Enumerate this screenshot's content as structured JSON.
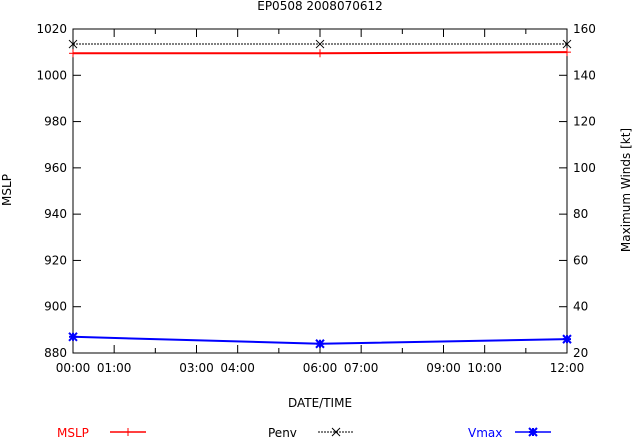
{
  "chart_data": {
    "type": "line",
    "title": "EP0508 2008070612",
    "xlabel": "DATE/TIME",
    "ylabel": "MSLP",
    "y2label": "Maximum Winds [kt]",
    "x": [
      0,
      6,
      12
    ],
    "x_tick_values": [
      0,
      1,
      3,
      4,
      6,
      7,
      9,
      10,
      12
    ],
    "x_tick_labels": [
      "00:00",
      "01:00",
      "03:00",
      "04:00",
      "06:00",
      "07:00",
      "09:00",
      "10:00",
      "12:00"
    ],
    "xlim": [
      0,
      12
    ],
    "ylim": [
      880,
      1020
    ],
    "y_ticks": [
      880,
      900,
      920,
      940,
      960,
      980,
      1000,
      1020
    ],
    "y2lim": [
      20,
      160
    ],
    "y2_ticks": [
      20,
      40,
      60,
      80,
      100,
      120,
      140,
      160
    ],
    "grid": false,
    "legend_placement": "bottom",
    "series": [
      {
        "name": "MSLP",
        "axis": "left",
        "color": "#ff0000",
        "marker": "plus",
        "dash": "solid",
        "values": [
          1009.5,
          1009.5,
          1010
        ]
      },
      {
        "name": "Penv",
        "axis": "left",
        "color": "#000000",
        "marker": "cross",
        "dash": "dotted",
        "values": [
          1013.5,
          1013.5,
          1013.5
        ]
      },
      {
        "name": "Vmax",
        "axis": "right",
        "color": "#0000ff",
        "marker": "star",
        "dash": "solid",
        "values": [
          27,
          24,
          26
        ]
      }
    ]
  }
}
